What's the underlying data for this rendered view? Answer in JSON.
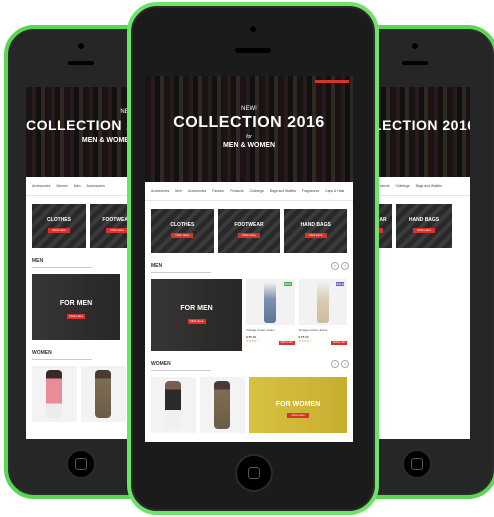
{
  "hero": {
    "new_label": "NEW!",
    "title": "COLLECTION 2016",
    "for_label": "for",
    "subtitle": "MEN & WOMEN"
  },
  "menu": [
    "Accessories",
    "Women",
    "Men",
    "Accessories",
    "Fashion",
    "Products",
    "Clothings",
    "Bags and Wallets",
    "Fragrances",
    "Caps & Hats"
  ],
  "categories": [
    {
      "label": "CLOTHES",
      "button": "Click Here"
    },
    {
      "label": "FOOTWEAR",
      "button": "Click Here"
    },
    {
      "label": "HAND BAGS",
      "button": "Click Here"
    }
  ],
  "men_section": {
    "title": "MEN",
    "banner_label": "FOR MEN",
    "banner_button": "Click Here",
    "products": [
      {
        "name": "Vintage Cotton Jeans",
        "price": "$ 85.99",
        "badge": "NEW",
        "stars": "★★★★☆",
        "cart": "Add to cart"
      },
      {
        "name": "Vintage Cotton Jeans",
        "price": "$ 85.99",
        "badge": "SALE",
        "stars": "★★★★☆",
        "cart": "Add to cart"
      }
    ]
  },
  "women_section": {
    "title": "WOMEN",
    "banner_label": "FOR WOMEN",
    "banner_button": "Click Here"
  },
  "colors": {
    "phone_frame": "#6ee36a",
    "accent": "#d8312e"
  }
}
